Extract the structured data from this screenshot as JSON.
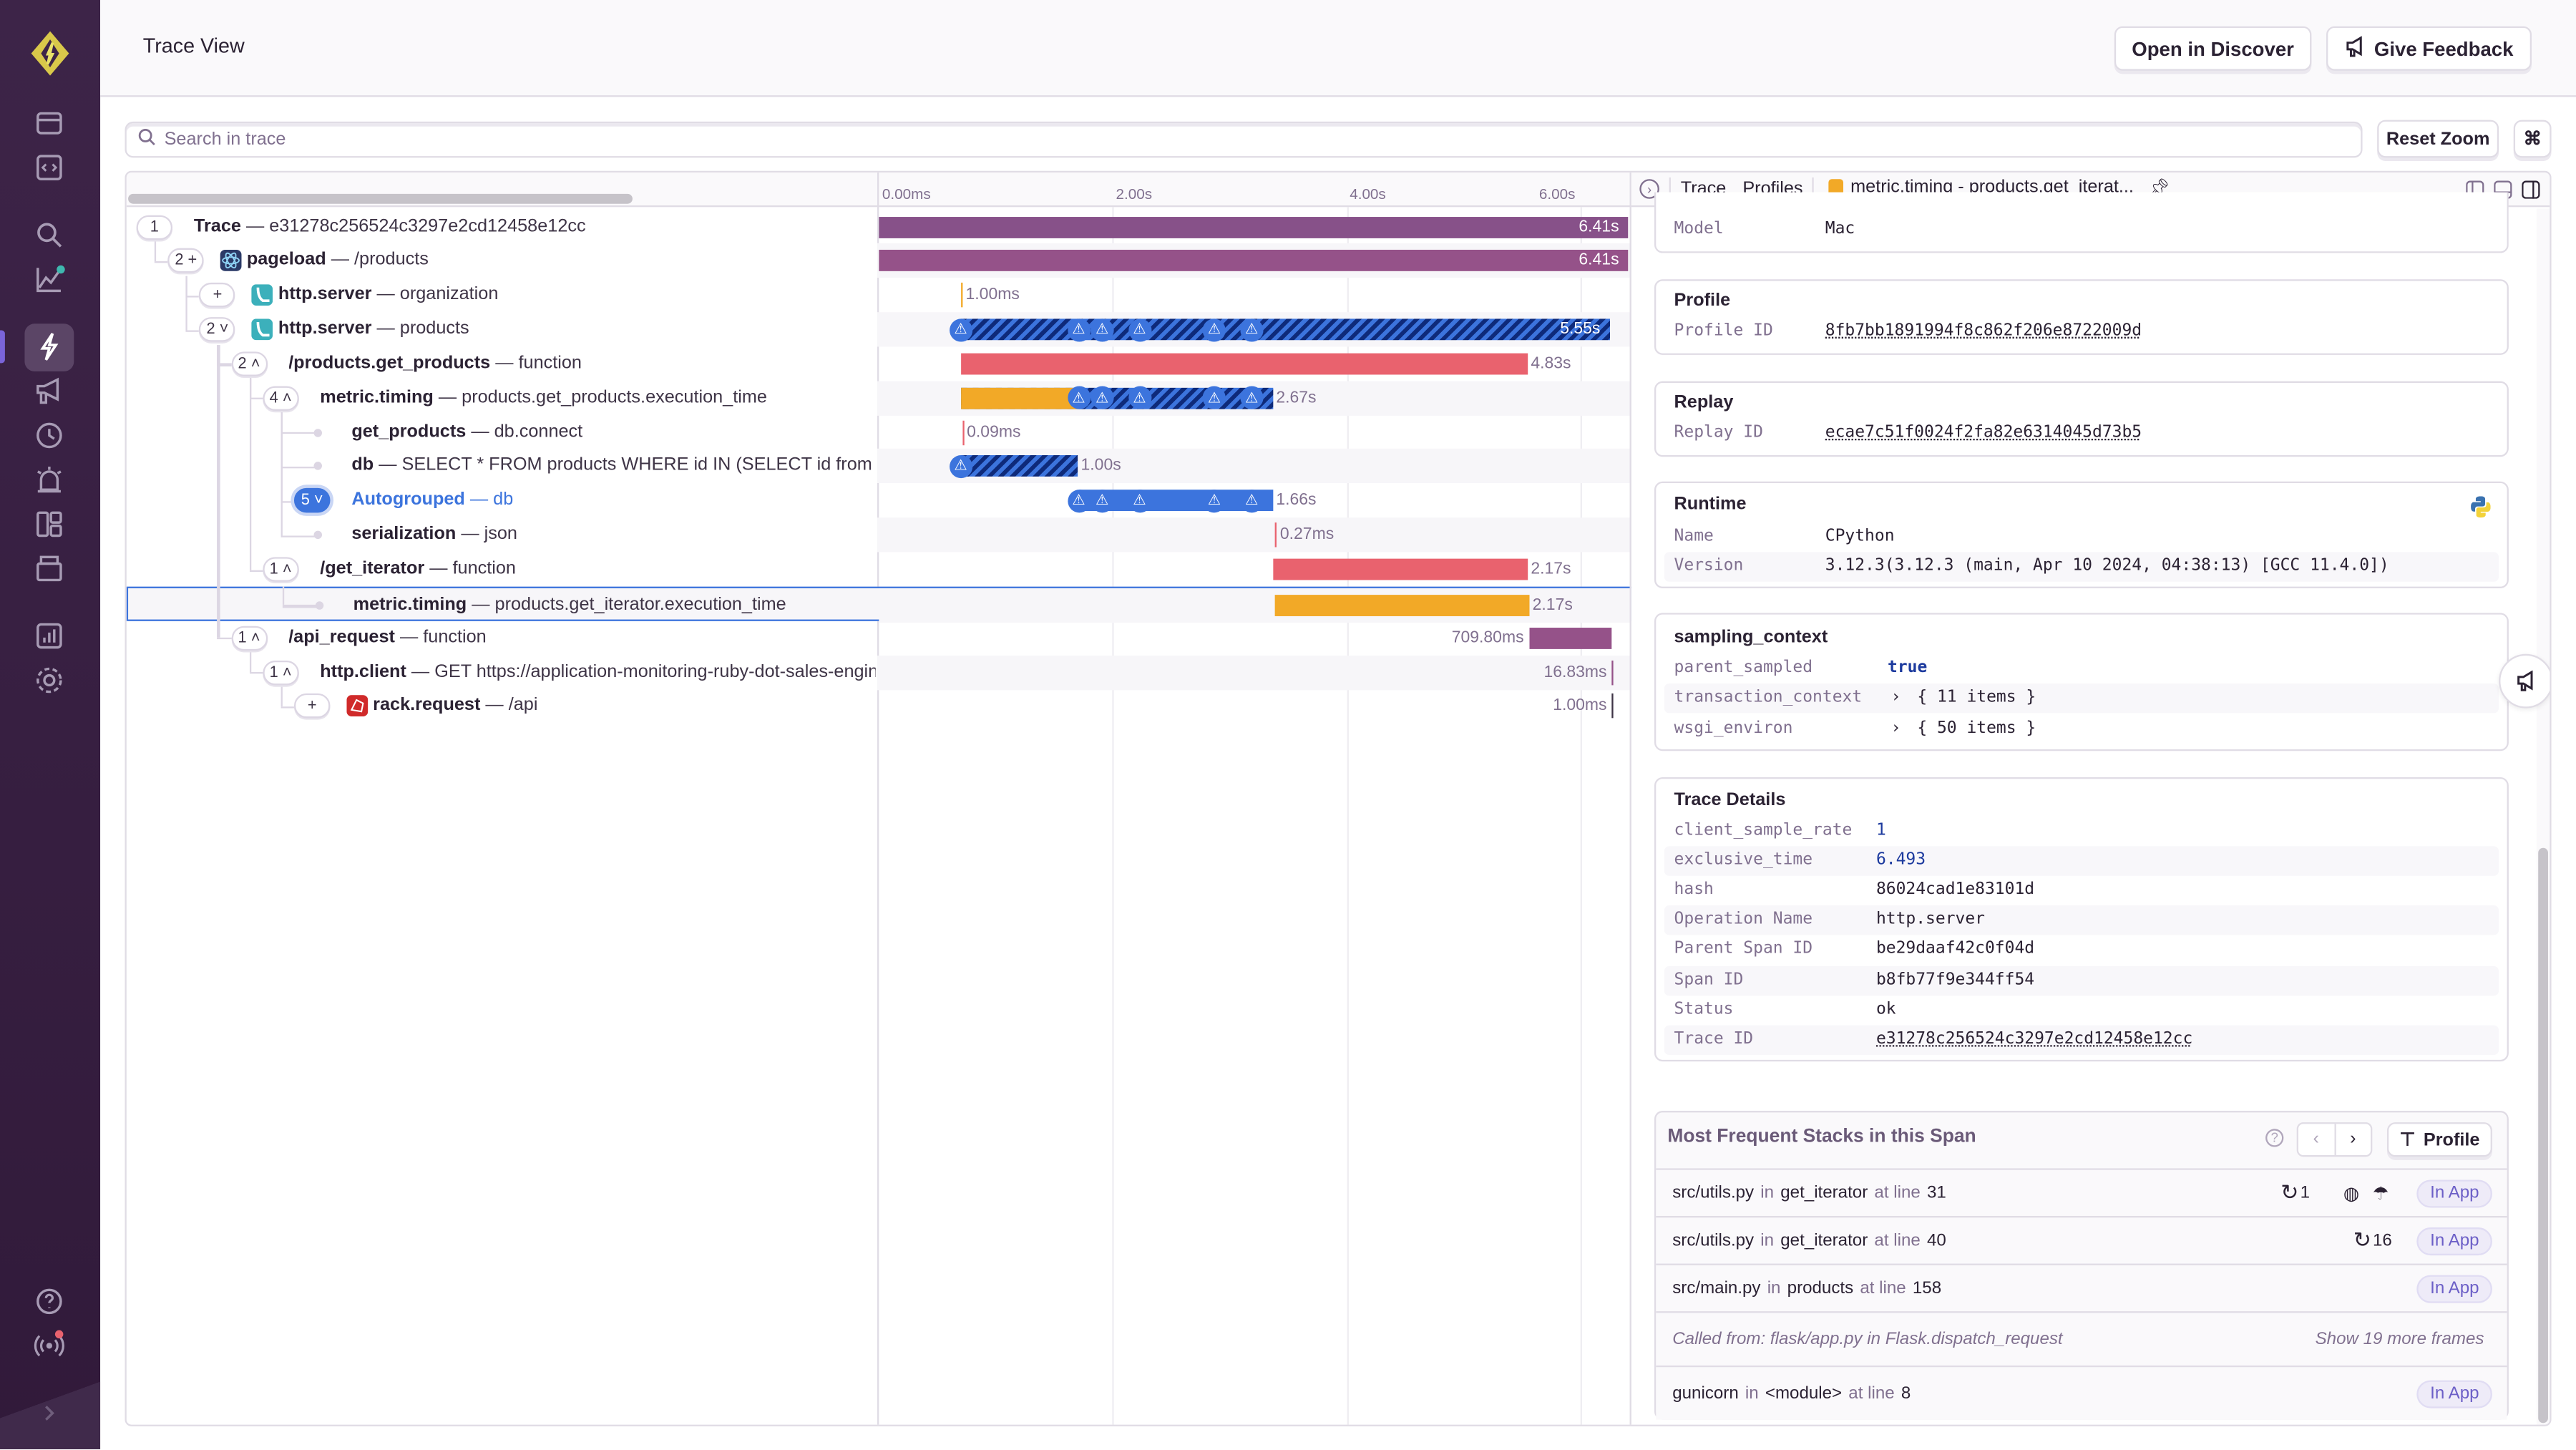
{
  "header": {
    "title": "Trace View",
    "open_discover": "Open in Discover",
    "give_feedback": "Give Feedback"
  },
  "toolbar": {
    "search_placeholder": "Search in trace",
    "reset_zoom": "Reset Zoom",
    "shortcut": "⌘"
  },
  "sidebar": {
    "items": [
      "issues-icon",
      "projects-icon",
      "search-icon",
      "performance-icon",
      "traces-icon",
      "feedback-icon",
      "releases-icon",
      "alerts-icon",
      "dashboards-icon",
      "stats-icon",
      "insights-icon",
      "settings-icon",
      "help-icon",
      "broadcast-icon",
      "collapse-icon"
    ],
    "active": "traces-icon"
  },
  "timeline": {
    "ticks": [
      {
        "value": 0,
        "label": "0.00ms"
      },
      {
        "value": 2,
        "label": "2.00s"
      },
      {
        "value": 4,
        "label": "4.00s"
      },
      {
        "value": 6,
        "label": "6.00s"
      }
    ],
    "max_s": 6.41
  },
  "colors": {
    "purple": "#875189",
    "purple2": "#955289",
    "red": "#e9626e",
    "orange": "#f2a927",
    "blue": "#3c74dd",
    "link": "#2562d4"
  },
  "spans": [
    {
      "depth": 0,
      "badge": "1",
      "op": "Trace",
      "desc": "e31278c256524c3297e2cd12458e12cc",
      "icon": null,
      "start": 0,
      "dur": 6.41,
      "label": "6.41s",
      "style": "solid",
      "color": "#875189",
      "label_pos": "inside",
      "warnings": []
    },
    {
      "depth": 1,
      "badge": "2 +",
      "op": "pageload",
      "desc": "/products",
      "icon": "react",
      "start": 0,
      "dur": 6.41,
      "label": "6.41s",
      "style": "solid",
      "color": "#955289",
      "label_pos": "inside",
      "warnings": []
    },
    {
      "depth": 2,
      "badge": "+",
      "op": "http.server",
      "desc": "organization",
      "icon": "flask",
      "start": 0.7,
      "dur": 0,
      "label": "1.00ms",
      "style": "line",
      "color": "#f2a927",
      "label_pos": "after",
      "warnings": []
    },
    {
      "depth": 2,
      "badge": "2 ˅",
      "op": "http.server",
      "desc": "products",
      "icon": "flask",
      "start": 0.7,
      "dur": 5.55,
      "label": "5.55s",
      "style": "hatched",
      "color": "#3c74dd",
      "label_pos": "inside",
      "warnings": [
        0.7,
        1.71,
        1.91,
        2.23,
        2.87,
        3.19
      ]
    },
    {
      "depth": 3,
      "badge": "2 ˄",
      "op": "/products.get_products",
      "desc": "function",
      "icon": null,
      "start": 0.7,
      "dur": 4.85,
      "label": "4.83s",
      "style": "solid",
      "color": "#e9626e",
      "label_pos": "after",
      "warnings": []
    },
    {
      "depth": 4,
      "badge": "4 ˄",
      "op": "metric.timing",
      "desc": "products.get_products.execution_time",
      "icon": null,
      "start": 0.7,
      "dur": 2.67,
      "label": "2.67s",
      "style": "orange-hatched",
      "color": "#f2a927",
      "label_pos": "after",
      "warnings": [
        1.71,
        1.91,
        2.23,
        2.87,
        3.19
      ],
      "hatch_from": 1.71
    },
    {
      "depth": 5,
      "badge": null,
      "op": "get_products",
      "desc": "db.connect",
      "icon": null,
      "start": 0.71,
      "dur": 0,
      "label": "0.09ms",
      "style": "line",
      "color": "#e9626e",
      "label_pos": "after",
      "warnings": []
    },
    {
      "depth": 5,
      "badge": null,
      "op": "db",
      "desc": "SELECT * FROM products WHERE id IN (SELECT id from products)",
      "icon": null,
      "start": 0.7,
      "dur": 1.0,
      "label": "1.00s",
      "style": "hatched",
      "color": "#3c74dd",
      "label_pos": "after",
      "warnings": [
        0.7
      ]
    },
    {
      "depth": 5,
      "badge": "5 ˅",
      "badge_style": "blue",
      "op": "Autogrouped",
      "desc": "db",
      "icon": null,
      "start": 1.71,
      "dur": 1.66,
      "label": "1.66s",
      "style": "solid",
      "color": "#3c74dd",
      "label_pos": "after",
      "warnings": [
        1.71,
        1.91,
        2.23,
        2.87,
        3.19
      ],
      "highlight": true
    },
    {
      "depth": 5,
      "badge": null,
      "op": "serialization",
      "desc": "json",
      "icon": null,
      "start": 3.39,
      "dur": 0,
      "label": "0.27ms",
      "style": "line",
      "color": "#e9626e",
      "label_pos": "after",
      "warnings": []
    },
    {
      "depth": 4,
      "badge": "1 ˄",
      "op": "/get_iterator",
      "desc": "function",
      "icon": null,
      "start": 3.38,
      "dur": 2.17,
      "label": "2.17s",
      "style": "solid",
      "color": "#e9626e",
      "label_pos": "after",
      "warnings": []
    },
    {
      "depth": 5,
      "badge": null,
      "op": "metric.timing",
      "desc": "products.get_iterator.execution_time",
      "icon": null,
      "start": 3.38,
      "dur": 2.17,
      "label": "2.17s",
      "style": "solid",
      "color": "#f2a927",
      "label_pos": "after",
      "warnings": [],
      "selected": true
    },
    {
      "depth": 3,
      "badge": "1 ˄",
      "op": "/api_request",
      "desc": "function",
      "icon": null,
      "start": 5.56,
      "dur": 0.71,
      "label": "709.80ms",
      "style": "solid",
      "color": "#955289",
      "label_pos": "before",
      "warnings": []
    },
    {
      "depth": 4,
      "badge": "1 ˄",
      "op": "http.client",
      "desc": "GET https://application-monitoring-ruby-dot-sales-engineering-sf.appspot.com/api",
      "icon": null,
      "start": 6.27,
      "dur": 0,
      "label": "16.83ms",
      "style": "line",
      "color": "#955289",
      "label_pos": "before",
      "warnings": []
    },
    {
      "depth": 5,
      "badge": "+",
      "op": "rack.request",
      "desc": "/api",
      "icon": "ruby",
      "start": 6.27,
      "dur": 0,
      "label": "1.00ms",
      "style": "line",
      "color": "#3e3446",
      "label_pos": "before",
      "warnings": []
    }
  ],
  "drawer": {
    "tabs": {
      "trace": "Trace",
      "profiles": "Profiles",
      "active": "metric.timing - products.get_iterat..."
    },
    "device": {
      "model_key": "Model",
      "model_val": "Mac"
    },
    "profile": {
      "title": "Profile",
      "key": "Profile ID",
      "value": "8fb7bb1891994f8c862f206e8722009d"
    },
    "replay": {
      "title": "Replay",
      "key": "Replay ID",
      "value": "ecae7c51f0024f2fa82e6314045d73b5"
    },
    "runtime": {
      "title": "Runtime",
      "rows": [
        {
          "k": "Name",
          "v": "CPython"
        },
        {
          "k": "Version",
          "v": "3.12.3(3.12.3 (main, Apr 10 2024, 04:38:13) [GCC 11.4.0])"
        }
      ]
    },
    "sampling": {
      "title": "sampling_context",
      "rows": [
        {
          "k": "parent_sampled",
          "v": "true"
        },
        {
          "k": "transaction_context",
          "v": "{ 11 items }"
        },
        {
          "k": "wsgi_environ",
          "v": "{ 50 items }"
        }
      ]
    },
    "trace_details": {
      "title": "Trace Details",
      "rows": [
        {
          "k": "client_sample_rate",
          "v": "1"
        },
        {
          "k": "exclusive_time",
          "v": "6.493"
        },
        {
          "k": "hash",
          "v": "86024cad1e83101d"
        },
        {
          "k": "Operation Name",
          "v": "http.server"
        },
        {
          "k": "Parent Span ID",
          "v": "be29daaf42c0f04d"
        },
        {
          "k": "Span ID",
          "v": "b8fb77f9e344ff54"
        },
        {
          "k": "Status",
          "v": "ok"
        },
        {
          "k": "Trace ID",
          "v": "e31278c256524c3297e2cd12458e12cc"
        }
      ]
    },
    "stacks": {
      "title": "Most Frequent Stacks in this Span",
      "profile_btn": "Profile",
      "in": "in",
      "at_line": "at line",
      "in_app": "In App",
      "frames": [
        {
          "file": "src/utils.py",
          "func": "get_iterator",
          "line": "31",
          "repeat": "1"
        },
        {
          "file": "src/utils.py",
          "func": "get_iterator",
          "line": "40",
          "repeat": "16"
        },
        {
          "file": "src/main.py",
          "func": "products",
          "line": "158"
        }
      ],
      "called_from": "Called from: flask/app.py  in  Flask.dispatch_request",
      "show_more": "Show 19 more frames",
      "last": {
        "file": "gunicorn",
        "func": "<module>",
        "line": "8"
      }
    }
  }
}
